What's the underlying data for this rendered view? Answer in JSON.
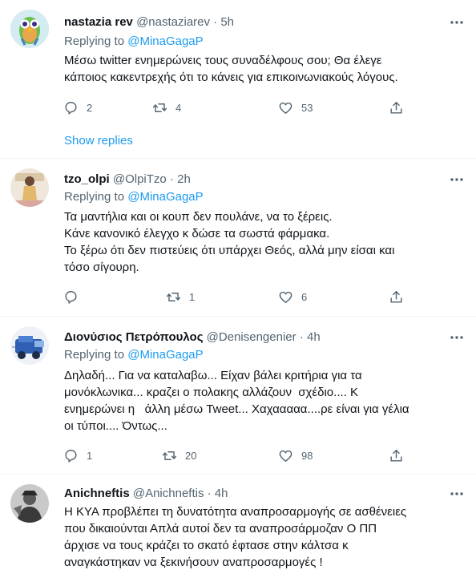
{
  "replying_label": "Replying to",
  "icons": [
    "reply-icon",
    "retweet-icon",
    "like-icon",
    "share-icon",
    "more-icon"
  ],
  "colors": {
    "accent": "#1d9bf0",
    "secondary_text": "#536471",
    "divider": "#eff3f4"
  },
  "tweets": [
    {
      "name": "nastazia rev",
      "handle": "@nastaziarev",
      "time": "· 5h",
      "mention": "@MinaGagaP",
      "lines": [
        "Μέσω twitter ενημερώνεις τους συναδέλφους σου; Θα έλεγε",
        "κάποιος κακεντρεχής ότι το κάνεις για επικοινωνιακούς λόγους."
      ],
      "replies": "2",
      "retweets": "4",
      "likes": "53",
      "show_replies": "Show replies"
    },
    {
      "name": "tzo_olpi",
      "handle": "@OlpiTzo",
      "time": "· 2h",
      "mention": "@MinaGagaP",
      "lines": [
        "Τα μαντήλια και οι κουπ δεν πουλάνε, να το ξέρεις.",
        "Κάνε κανονικό έλεγχο κ δώσε τα σωστά φάρμακα.",
        "Το ξέρω ότι δεν πιστεύεις ότι υπάρχει Θεός, αλλά μην είσαι και",
        "τόσο σίγουρη."
      ],
      "replies": "",
      "retweets": "1",
      "likes": "6"
    },
    {
      "name": "Διονύσιος Πετρόπουλος",
      "handle": "@Denisengenier",
      "time": "· 4h",
      "mention": "@MinaGagaP",
      "lines": [
        "Δηλαδή... Για να καταλαβω... Είχαν βάλει κριτήρια για τα",
        "μονόκλωνικα... κραζει ο πολακης αλλάζουν  σχέδιο.... Κ",
        "ενημερώνει η   άλλη μέσω Tweet... Χαχααααα....ρε είναι για γέλια",
        "οι τύποι.... Όντως..."
      ],
      "replies": "1",
      "retweets": "20",
      "likes": "98"
    },
    {
      "name": "Anichneftis",
      "handle": "@Anichneftis",
      "time": "· 4h",
      "lines": [
        "Η ΚΥΑ προβλέπει τη δυνατότητα αναπροσαρμογής σε ασθένειες",
        "που δικαιούνται Απλά αυτοί δεν τα αναπροσάρμοζαν Ο ΠΠ",
        "άρχισε να τους κράζει το σκατό έφτασε στην κάλτσα κ",
        "αναγκάστηκαν να ξεκινήσουν αναπροσαρμογές !"
      ]
    }
  ]
}
